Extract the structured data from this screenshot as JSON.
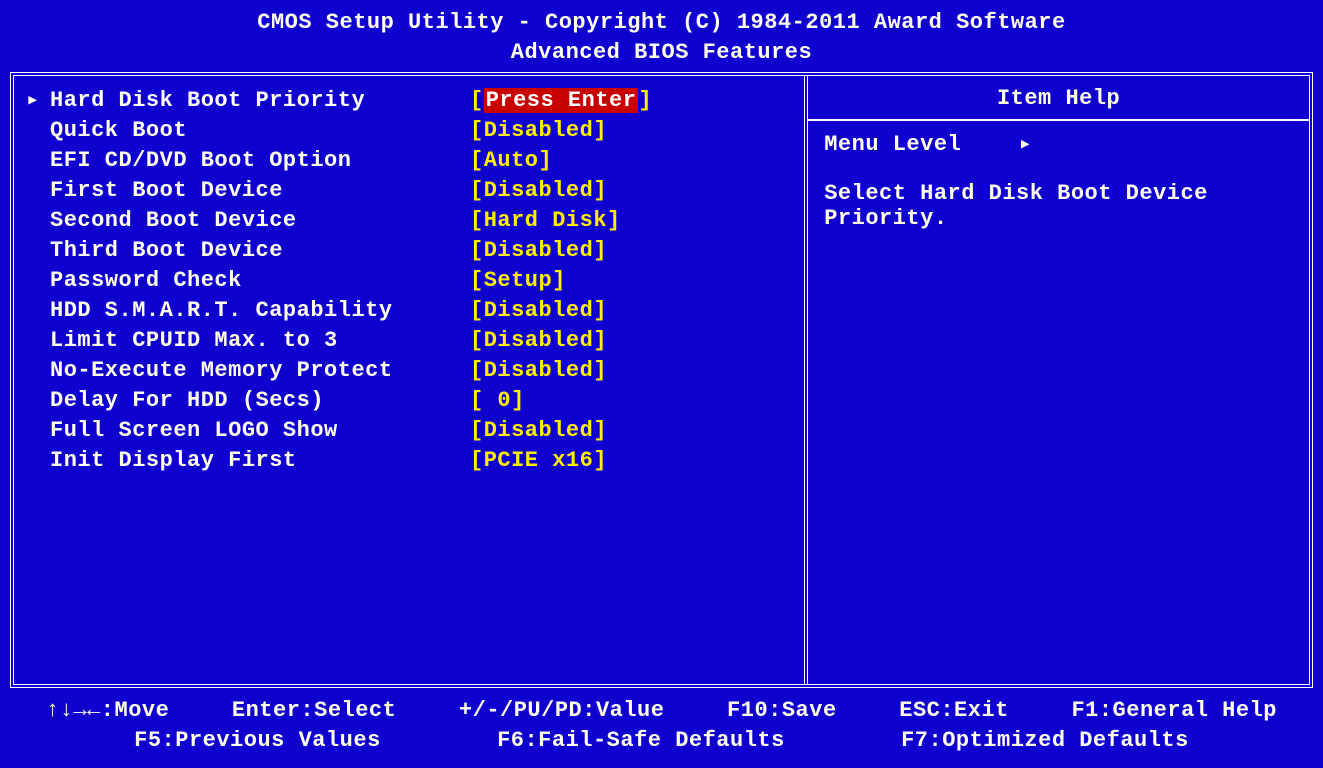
{
  "header": {
    "line1": "CMOS Setup Utility - Copyright (C) 1984-2011 Award Software",
    "line2": "Advanced BIOS Features"
  },
  "items": [
    {
      "label": "Hard Disk Boot Priority",
      "value": "Press Enter",
      "selected": true
    },
    {
      "label": "Quick Boot",
      "value": "Disabled",
      "selected": false
    },
    {
      "label": "EFI CD/DVD Boot Option",
      "value": "Auto",
      "selected": false
    },
    {
      "label": "First Boot Device",
      "value": "Disabled",
      "selected": false
    },
    {
      "label": "Second Boot Device",
      "value": "Hard Disk",
      "selected": false
    },
    {
      "label": "Third Boot Device",
      "value": "Disabled",
      "selected": false
    },
    {
      "label": "Password Check",
      "value": "Setup",
      "selected": false
    },
    {
      "label": "HDD S.M.A.R.T. Capability",
      "value": "Disabled",
      "selected": false
    },
    {
      "label": "Limit CPUID Max. to 3",
      "value": "Disabled",
      "selected": false
    },
    {
      "label": "No-Execute Memory Protect",
      "value": "Disabled",
      "selected": false
    },
    {
      "label": "Delay For HDD (Secs)",
      "value": " 0",
      "selected": false
    },
    {
      "label": "Full Screen LOGO Show",
      "value": "Disabled",
      "selected": false
    },
    {
      "label": "Init Display First",
      "value": "PCIE x16",
      "selected": false
    }
  ],
  "help": {
    "title": "Item Help",
    "menu_level_label": "Menu Level",
    "text": "Select Hard Disk Boot Device Priority."
  },
  "footer": {
    "row1": {
      "move": "↑↓→←:Move",
      "select": "Enter:Select",
      "value": "+/-/PU/PD:Value",
      "save": "F10:Save",
      "exit": "ESC:Exit",
      "help": "F1:General Help"
    },
    "row2": {
      "prev": "F5:Previous Values",
      "fsafe": "F6:Fail-Safe Defaults",
      "opt": "F7:Optimized Defaults"
    }
  }
}
